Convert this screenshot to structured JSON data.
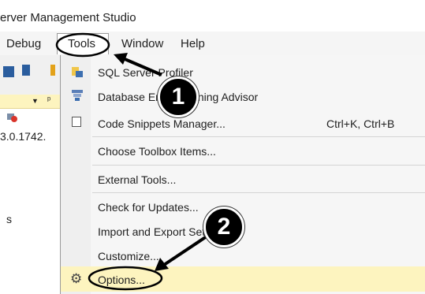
{
  "window": {
    "title": "erver Management Studio"
  },
  "menubar": {
    "items": [
      {
        "label": "Debug"
      },
      {
        "label": "Tools"
      },
      {
        "label": "Window"
      },
      {
        "label": "Help"
      }
    ]
  },
  "left_panel": {
    "version_text": "3.0.1742.",
    "partial_text": "s"
  },
  "tools_menu": {
    "items": [
      {
        "label": "SQL Server Profiler",
        "shortcut": ""
      },
      {
        "label": "Database Engine Tuning Advisor",
        "shortcut": ""
      },
      {
        "label": "Code Snippets Manager...",
        "shortcut": "Ctrl+K, Ctrl+B"
      },
      {
        "label": "Choose Toolbox Items...",
        "shortcut": ""
      },
      {
        "label": "External Tools...",
        "shortcut": ""
      },
      {
        "label": "Check for Updates...",
        "shortcut": ""
      },
      {
        "label": "Import and Export Settings...",
        "shortcut": ""
      },
      {
        "label": "Customize...",
        "shortcut": ""
      },
      {
        "label": "Options...",
        "shortcut": ""
      }
    ]
  },
  "annotations": {
    "step1": "1",
    "step2": "2"
  },
  "colors": {
    "highlight": "#fdf4bf",
    "callout": "#000000"
  }
}
